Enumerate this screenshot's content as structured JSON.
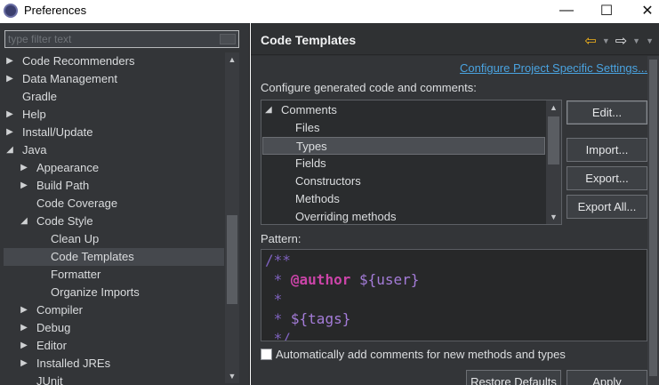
{
  "window": {
    "title": "Preferences",
    "minimize_glyph": "—",
    "maximize_glyph": "☐",
    "close_glyph": "✕"
  },
  "filter": {
    "placeholder": "type filter text"
  },
  "tree": {
    "items": [
      {
        "label": "Code Recommenders",
        "arrow": "▶"
      },
      {
        "label": "Data Management",
        "arrow": "▶"
      },
      {
        "label": "Gradle",
        "arrow": ""
      },
      {
        "label": "Help",
        "arrow": "▶"
      },
      {
        "label": "Install/Update",
        "arrow": "▶"
      },
      {
        "label": "Java",
        "arrow": "◢"
      },
      {
        "label": "Appearance",
        "arrow": "▶"
      },
      {
        "label": "Build Path",
        "arrow": "▶"
      },
      {
        "label": "Code Coverage",
        "arrow": ""
      },
      {
        "label": "Code Style",
        "arrow": "◢"
      },
      {
        "label": "Clean Up",
        "arrow": ""
      },
      {
        "label": "Code Templates",
        "arrow": ""
      },
      {
        "label": "Formatter",
        "arrow": ""
      },
      {
        "label": "Organize Imports",
        "arrow": ""
      },
      {
        "label": "Compiler",
        "arrow": "▶"
      },
      {
        "label": "Debug",
        "arrow": "▶"
      },
      {
        "label": "Editor",
        "arrow": "▶"
      },
      {
        "label": "Installed JREs",
        "arrow": "▶"
      },
      {
        "label": "JUnit",
        "arrow": ""
      }
    ]
  },
  "page": {
    "title": "Code Templates",
    "back_glyph": "⇦",
    "forward_glyph": "⇨",
    "dropdown_glyph": "▼",
    "configure_link": "Configure Project Specific Settings...",
    "description": "Configure generated code and comments:"
  },
  "templates": {
    "items": [
      {
        "label": "Comments",
        "arrow": "◢"
      },
      {
        "label": "Files",
        "arrow": ""
      },
      {
        "label": "Types",
        "arrow": ""
      },
      {
        "label": "Fields",
        "arrow": ""
      },
      {
        "label": "Constructors",
        "arrow": ""
      },
      {
        "label": "Methods",
        "arrow": ""
      },
      {
        "label": "Overriding methods",
        "arrow": ""
      }
    ]
  },
  "buttons": {
    "edit": "Edit...",
    "import": "Import...",
    "export": "Export...",
    "export_all": "Export All...",
    "restore_defaults": "Restore Defaults",
    "apply": "Apply"
  },
  "pattern": {
    "label": "Pattern:",
    "lines": {
      "l1": "/**",
      "l2_prefix": " * ",
      "l2_tag": "@author",
      "l2_var": " ${user}",
      "l3": " *",
      "l4_prefix": " * ",
      "l4_var": "${tags}",
      "l5": " */"
    }
  },
  "auto_comments": {
    "label": "Automatically add comments for new methods and types",
    "checked": false
  },
  "scroll_glyphs": {
    "up": "▲",
    "down": "▼"
  },
  "colors": {
    "accent_link": "#4aa3e0",
    "back_arrow": "#f2b21c",
    "comment": "#7f62bf",
    "javadoc_tag": "#cb44a8",
    "template_variable": "#a47cd8"
  }
}
